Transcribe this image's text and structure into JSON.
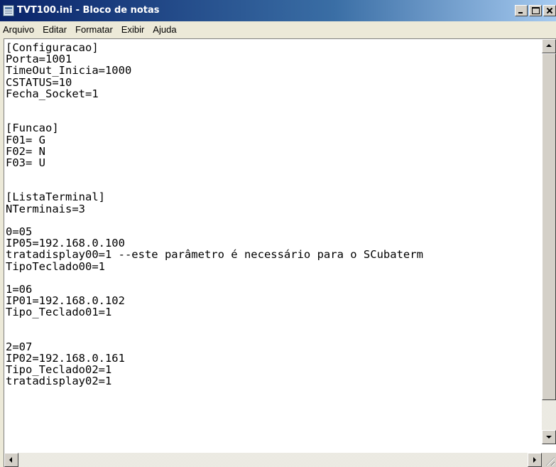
{
  "window": {
    "title": "TVT100.ini - Bloco de notas",
    "icon": "notepad-icon"
  },
  "menu": {
    "items": [
      {
        "label": "Arquivo"
      },
      {
        "label": "Editar"
      },
      {
        "label": "Formatar"
      },
      {
        "label": "Exibir"
      },
      {
        "label": "Ajuda"
      }
    ]
  },
  "editor": {
    "lines": [
      "[Configuracao]",
      "Porta=1001",
      "TimeOut_Inicia=1000",
      "CSTATUS=10",
      "Fecha_Socket=1",
      "",
      "",
      "[Funcao]",
      "F01= G",
      "F02= N",
      "F03= U",
      "",
      "",
      "[ListaTerminal]",
      "NTerminais=3",
      "",
      "0=05",
      "IP05=192.168.0.100",
      "tratadisplay00=1 --este parâmetro é necessário para o SCubaterm",
      "TipoTeclado00=1",
      "",
      "1=06",
      "IP01=192.168.0.102",
      "Tipo_Teclado01=1",
      "",
      "",
      "2=07",
      "IP02=192.168.0.161",
      "Tipo_Teclado02=1",
      "tratadisplay02=1"
    ]
  }
}
